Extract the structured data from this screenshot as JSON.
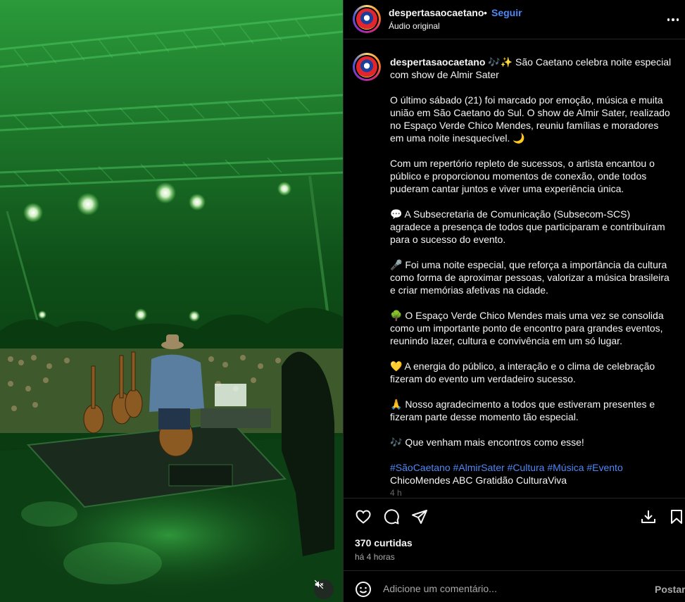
{
  "media": {
    "mute_icon": "speaker-muted-icon"
  },
  "header": {
    "username": "despertasaocaetano",
    "separator": "•",
    "follow_label": "Seguir",
    "audio_label": "Áudio original",
    "more_icon": "more-horizontal-icon"
  },
  "caption": {
    "username": "despertasaocaetano",
    "title": "🎶✨ São Caetano celebra noite especial com show de Almir Sater",
    "paragraphs": [
      "O último sábado (21) foi marcado por emoção, música e muita união em São Caetano do Sul. O show de Almir Sater, realizado no Espaço Verde Chico Mendes, reuniu famílias e moradores em uma noite inesquecível. 🌙",
      "Com um repertório repleto de sucessos, o artista encantou o público e proporcionou momentos de conexão, onde todos puderam cantar juntos e viver uma experiência única.",
      "💬 A Subsecretaria de Comunicação (Subsecom-SCS) agradece a presença de todos que participaram e contribuíram para o sucesso do evento.",
      "🎤 Foi uma noite especial, que reforça a importância da cultura como forma de aproximar pessoas, valorizar a música brasileira e criar memórias afetivas na cidade.",
      "🌳 O Espaço Verde Chico Mendes mais uma vez se consolida como um importante ponto de encontro para grandes eventos, reunindo lazer, cultura e convivência em um só lugar.",
      "💛 A energia do público, a interação e o clima de celebração fizeram do evento um verdadeiro sucesso.",
      "🙏 Nosso agradecimento a todos que estiveram presentes e fizeram parte desse momento tão especial.",
      "🎶 Que venham mais encontros como esse!"
    ],
    "hashtags": "#SãoCaetano #AlmirSater #Cultura #Música #Evento",
    "extra_tags": "ChicoMendes ABC Gratidão CulturaViva",
    "time": "4 h"
  },
  "actions": {
    "like_icon": "heart-icon",
    "comment_icon": "comment-icon",
    "share_icon": "send-icon",
    "download_icon": "download-icon",
    "save_icon": "bookmark-icon"
  },
  "stats": {
    "likes": "370 curtidas",
    "posted_ago": "há 4 horas"
  },
  "comment": {
    "placeholder": "Adicione um comentário...",
    "post_label": "Postar",
    "emoji_icon": "emoji-icon"
  },
  "colors": {
    "accent_blue": "#4f88f5",
    "background": "#000000",
    "text": "#f5f5f5",
    "muted": "#a8a8a8",
    "stage_green": "#1e6b2a"
  }
}
